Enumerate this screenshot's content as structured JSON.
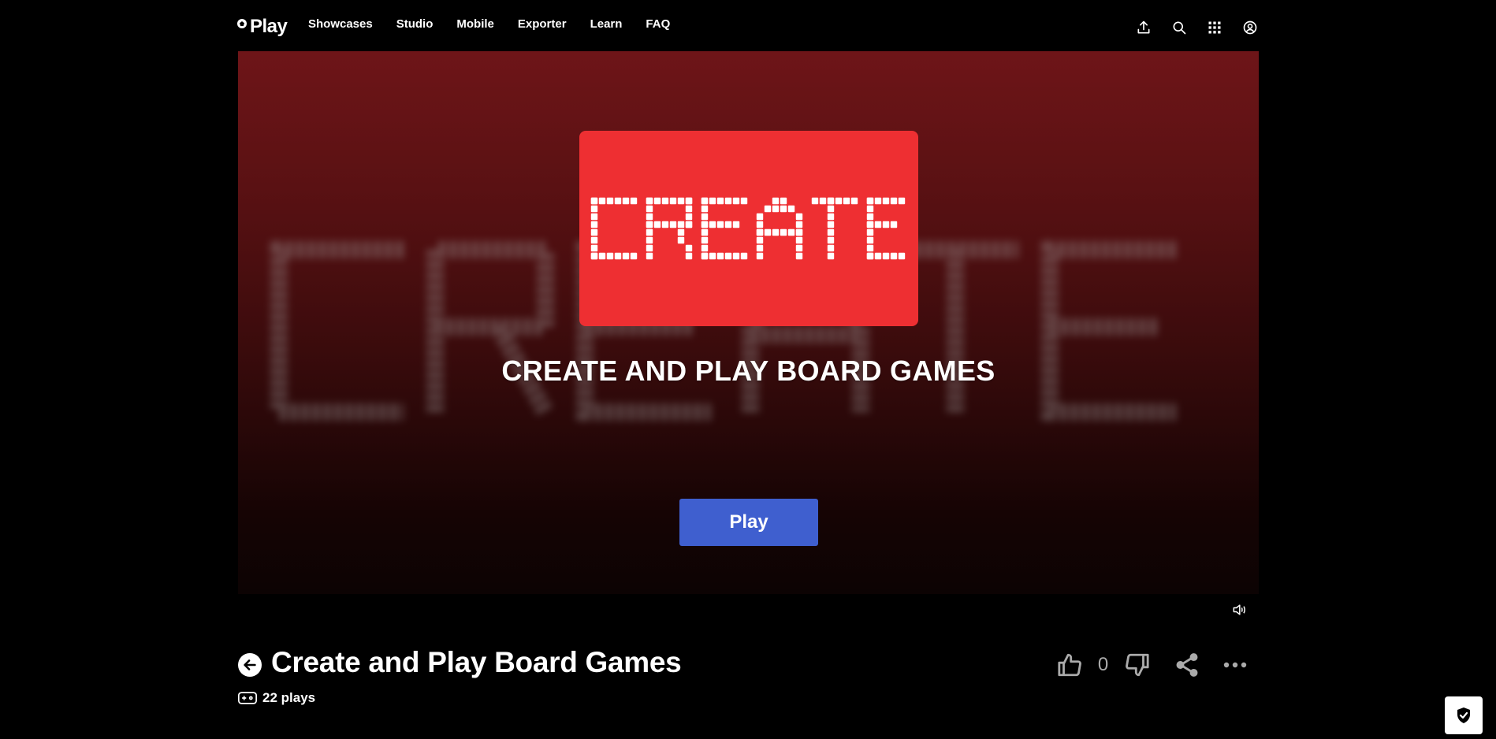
{
  "nav": {
    "logo_text": "Play",
    "menu": [
      "Showcases",
      "Studio",
      "Mobile",
      "Exporter",
      "Learn",
      "FAQ"
    ],
    "icons": [
      "upload-icon",
      "search-icon",
      "apps-grid-icon",
      "account-icon"
    ]
  },
  "hero": {
    "card_word": "CREATE",
    "title": "CREATE AND PLAY BOARD GAMES",
    "play_label": "Play",
    "card_color": "#ee2f32",
    "play_color": "#3f5fcf"
  },
  "game": {
    "title": "Create and Play Board Games",
    "plays": "22 plays",
    "like_count": "0"
  }
}
